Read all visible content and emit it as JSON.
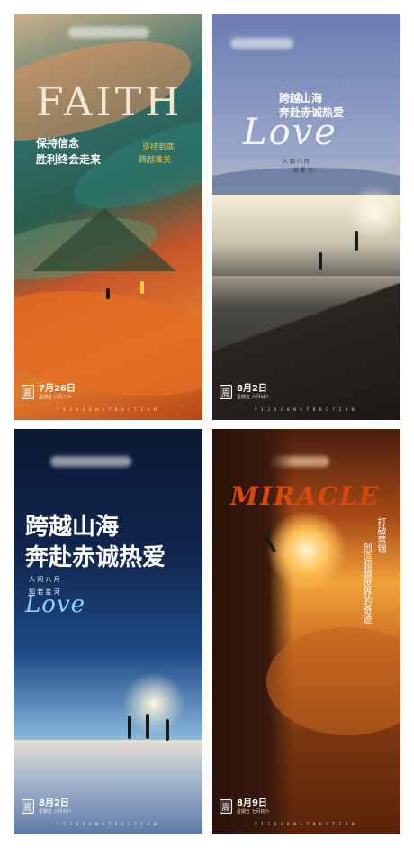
{
  "posters": [
    {
      "title": "FAITH",
      "headline_line1": "保持信念",
      "headline_line2": "胜利终会走来",
      "vertical_line1": "坚持到底",
      "vertical_line2": "跨越难关",
      "date": "7月26日",
      "date_sub": "星期五 六月二十",
      "logo_glyph": "周",
      "footer": "YIJUCONSTRUCTION"
    },
    {
      "headline_line1": "跨越山海",
      "headline_line2": "奔赴赤诚热爱",
      "script_word": "Love",
      "small_line1": "人 知 八 月",
      "small_line2": "若 星 河",
      "date": "8月2日",
      "date_sub": "星期五 六月廿八",
      "logo_glyph": "周",
      "footer": "YIJUCONSTRUCTION"
    },
    {
      "headline_line1": "跨越山海",
      "headline_line2": "奔赴赤诚热爱",
      "small_line1": "人 间 八 月",
      "small_line2": "知 若 星 河",
      "script_word": "Love",
      "date": "8月2日",
      "date_sub": "星期五 六月廿八",
      "logo_glyph": "周",
      "footer": "YIJUCONSTRUCTION"
    },
    {
      "title": "MIRACLE",
      "vertical_line1": "打破禁锢",
      "vertical_line2": "创造超越世界的奇迹",
      "date": "8月9日",
      "date_sub": "星期五 七月初六",
      "logo_glyph": "周",
      "footer": "YIJUCONSTRUCTION"
    }
  ],
  "colors": {
    "accent_orange": "#e07b2c",
    "faith_title": "#f3e6d2",
    "miracle_title": "#d9480f",
    "night_sky": "#0b1833"
  }
}
